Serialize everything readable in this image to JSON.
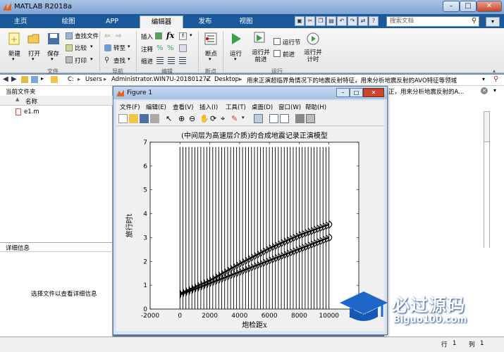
{
  "window": {
    "title": "MATLAB R2018a",
    "controls": [
      "–",
      "□",
      "✕"
    ]
  },
  "tabs": [
    {
      "label": "主页"
    },
    {
      "label": "绘图"
    },
    {
      "label": "APP"
    },
    {
      "label": "编辑器"
    },
    {
      "label": "发布"
    },
    {
      "label": "视图"
    }
  ],
  "search": {
    "placeholder": "搜索文档"
  },
  "ribbon": {
    "file": {
      "new": "新建",
      "open": "打开",
      "save": "保存",
      "find_files": "查找文件",
      "compare": "比较",
      "print": "打印",
      "group": "文件"
    },
    "nav": {
      "goto": "转至",
      "find": "查找",
      "group": "导航"
    },
    "edit": {
      "insert": "插入",
      "comment": "注释",
      "indent": "缩进",
      "group": "编辑"
    },
    "breakpoints": {
      "label": "断点",
      "group": "断点"
    },
    "run": {
      "run": "运行",
      "run_advance": "运行并前进",
      "run_section": "运行节",
      "advance": "前进",
      "run_time": "运行并计时",
      "group": "运行"
    }
  },
  "address": {
    "crumbs": [
      "C:",
      "Users",
      "Administrator.WIN7U-20180127Z",
      "Desktop",
      "用来正演超临界角情况下的地震反射特征，用来分析地震反射的AVO特征等领域"
    ],
    "separator": "▸"
  },
  "current_folder": {
    "title": "当前文件夹",
    "column_name": "名称",
    "sort_indicator": "▲",
    "files": [
      {
        "name": "e1.m"
      }
    ]
  },
  "details": {
    "title": "详细信息",
    "empty_text": "选择文件以查看详细信息"
  },
  "cmd_panel": {
    "path_tail": "正，用来分析地震反射的A..."
  },
  "statusbar": {
    "row_label": "行",
    "row": "1",
    "col_label": "列",
    "col": "1"
  },
  "figure": {
    "title": "Figure 1",
    "menus": [
      "文件(F)",
      "编辑(E)",
      "查看(V)",
      "插入(I)",
      "工具(T)",
      "桌面(D)",
      "窗口(W)",
      "帮助(H)"
    ]
  },
  "chart_data": {
    "type": "line",
    "title": "(中间层为高速层介质)的合成地震记录正演模型",
    "xlabel": "炮检距x",
    "ylabel": "旅行时t",
    "xlim": [
      -2000,
      12000
    ],
    "ylim": [
      0,
      7
    ],
    "xticks": [
      -2000,
      0,
      2000,
      4000,
      6000,
      8000,
      10000,
      12000
    ],
    "xtick_labels": [
      "-2000",
      "0",
      "2000",
      "4000",
      "6000",
      "8000",
      "10000",
      "12000"
    ],
    "yticks": [
      0,
      1,
      2,
      3,
      4,
      5,
      6,
      7
    ],
    "trace_offsets_start": 0,
    "trace_offsets_end": 10000,
    "trace_spacing": 200,
    "trace_top_time": 6.8,
    "reflection_events": [
      {
        "name": "direct",
        "x": [
          0,
          10000
        ],
        "t": [
          0.6,
          3.0
        ]
      },
      {
        "name": "reflection",
        "x": [
          0,
          2000,
          4000,
          6000,
          8000,
          10000
        ],
        "t": [
          0.65,
          1.2,
          1.9,
          2.55,
          3.1,
          3.55
        ]
      }
    ],
    "grid": false,
    "colors": {
      "trace": "#000000"
    }
  },
  "watermark": {
    "text": "必过源码",
    "sub": "Biguo100.com"
  }
}
